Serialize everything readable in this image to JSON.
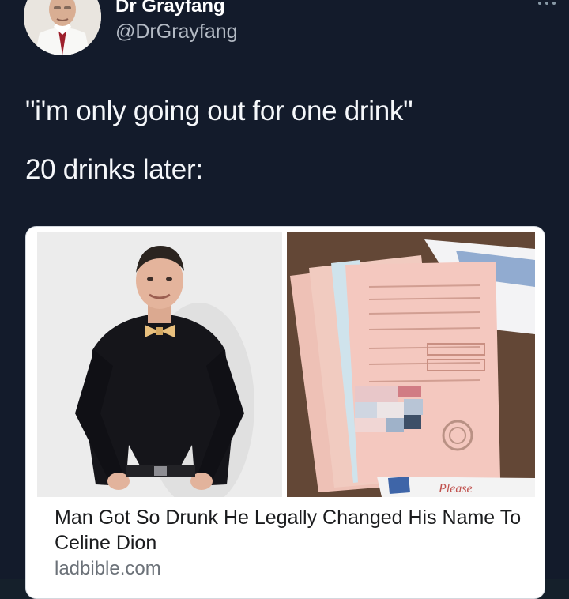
{
  "author": {
    "display_name": "Dr Grayfang",
    "handle": "@DrGrayfang"
  },
  "tweet": {
    "line1": "\"i'm only going out for one drink\"",
    "line2": "20 drinks later:"
  },
  "link_card": {
    "title": "Man Got So Drunk He Legally Changed His Name To Celine Dion",
    "domain": "ladbible.com",
    "watermark": "Please"
  },
  "icons": {
    "more": "more-horizontal-icon"
  },
  "colors": {
    "background": "#131b2b",
    "handle": "#b3bac4",
    "card_background": "#ffffff",
    "card_title": "#1b1c1e",
    "card_domain": "#6b7178"
  }
}
